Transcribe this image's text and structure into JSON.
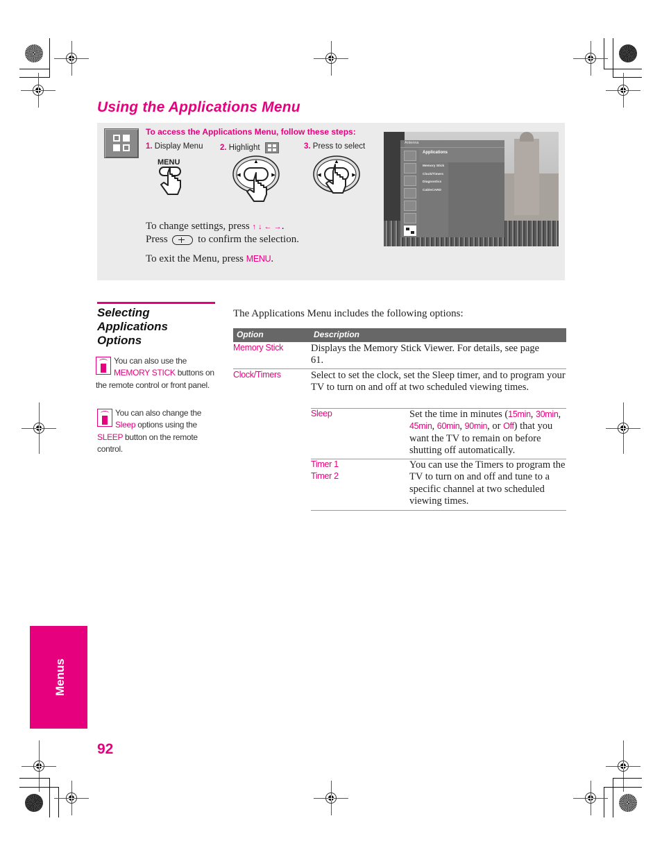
{
  "page": {
    "title": "Using the Applications Menu",
    "page_number": "92",
    "side_tab": "Menus"
  },
  "steps_panel": {
    "heading": "To access the Applications Menu, follow these steps:",
    "steps": [
      {
        "num": "1.",
        "label": "Display Menu"
      },
      {
        "num": "2.",
        "label": "Highlight"
      },
      {
        "num": "3.",
        "label": "Press to select"
      }
    ],
    "menu_button_label": "MENU",
    "change_settings_text": "To change settings, press",
    "arrow_glyphs": "↑ ↓ ← →",
    "press_text": "Press",
    "confirm_text": "to confirm the selection.",
    "exit_text": "To exit the Menu, press",
    "exit_key": "MENU",
    "icons": {
      "applications": "applications-grid-icon",
      "menu_press": "hand-pressing-menu-icon",
      "joystick_highlight": "joystick-arrow-icon",
      "joystick_select": "joystick-press-icon",
      "confirm_button": "joystick-center-button-icon"
    }
  },
  "tv_screenshot": {
    "source_label": "Antenna",
    "menu_title": "Applications",
    "items": [
      "Memory Stick",
      "Clock/Timers",
      "Diagnostics",
      "CableCARD"
    ],
    "sidebar_icons": [
      "picture-icon",
      "sound-icon",
      "screen-icon",
      "channel-icon",
      "parental-lock-icon",
      "setup-icon",
      "applications-icon"
    ],
    "selected_sidebar_index": 6
  },
  "section": {
    "title_lines": [
      "Selecting",
      "Applications",
      "Options"
    ],
    "tips": [
      {
        "icon": "remote-control-tip-icon",
        "pre": "You can also use the",
        "highlight": "MEMORY STICK",
        "post": "buttons on the remote control or front panel."
      },
      {
        "icon": "remote-control-tip-icon",
        "pre": "You can also change the",
        "highlight": "Sleep",
        "mid": "options using the",
        "highlight2": "SLEEP",
        "post": "button on the remote control."
      }
    ]
  },
  "table": {
    "intro": "The Applications Menu includes the following options:",
    "headers": [
      "Option",
      "Description"
    ],
    "rows": [
      {
        "option": "Memory Stick",
        "description": "Displays the Memory Stick Viewer. For details, see page 61."
      },
      {
        "option": "Clock/Timers",
        "description": "Select to set the clock, set the Sleep timer, and to program your TV to turn on and off at two scheduled viewing times."
      }
    ],
    "subrows": [
      {
        "option": "Sleep",
        "description_pre": "Set the time in minutes (",
        "values": [
          "15min",
          "30min",
          "45min",
          "60min",
          "90min",
          "Off"
        ],
        "description_post": "that you want the TV to remain on before shutting off automatically.",
        "or_word": "or"
      },
      {
        "options": [
          "Timer 1",
          "Timer 2"
        ],
        "description": "You can use the Timers to program the TV to turn on and off and tune to a specific channel at two scheduled viewing times."
      }
    ]
  },
  "colors": {
    "accent": "#e6007e",
    "table_header": "#676767",
    "panel_bg": "#ebebeb"
  }
}
